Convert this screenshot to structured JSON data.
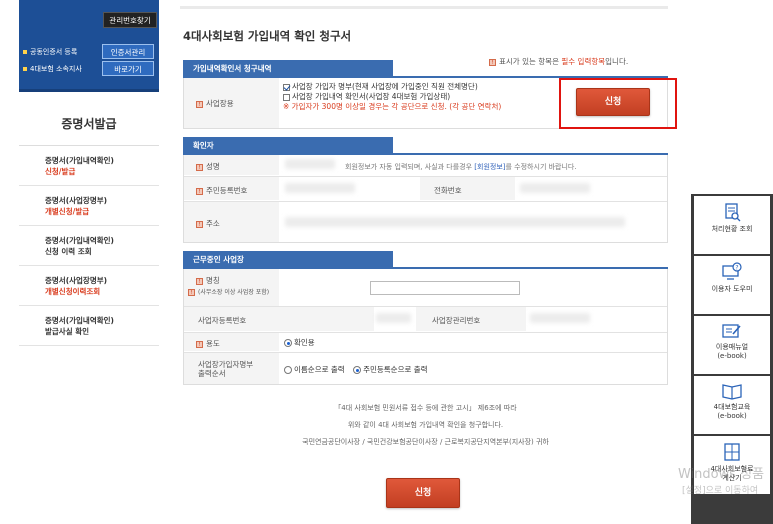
{
  "sidebar": {
    "find_button": "관리번호찾기",
    "rows": [
      {
        "label": "공동인증서 등록",
        "button": "인증서관리"
      },
      {
        "label": "4대보험 소속지사",
        "button": "바로가기"
      }
    ],
    "menu_title": "증명서발급",
    "items": [
      {
        "line1": "증명서(가입내역확인)",
        "line2": "신청/발급"
      },
      {
        "line1": "증명서(사업장명부)",
        "line2": "개별신청/발급"
      },
      {
        "line1": "증명서(가입내역확인)",
        "line2": "신청 이력 조회"
      },
      {
        "line1": "증명서(사업장명부)",
        "line2": "개별신청이력조회"
      },
      {
        "line1": "증명서(가입내역확인)",
        "line2": "발급사실 확인"
      }
    ]
  },
  "main": {
    "title": "4대사회보험 가입내역 확인 청구서",
    "required_note": {
      "prefix": "표시가 있는 항목은",
      "highlight": "필수 입력항목",
      "suffix": "입니다."
    },
    "section1": {
      "tab": "가입내역확인서 청구내역",
      "field_label": "사업장용",
      "options": [
        {
          "label": "사업장 가입자 명부(현재 사업장에 가입중인 직원 전체명단)",
          "checked": true
        },
        {
          "label": "사업장 가입내역 확인서(사업장 4대보험 가입상태)",
          "checked": false
        }
      ],
      "note": "※ 가입자가 300명 이상일 경우는 각 공단으로 신청. (각 공단 연락처)",
      "apply_button": "신청"
    },
    "section2": {
      "tab": "확인자",
      "name_label": "성명",
      "info_note": {
        "prefix": "회원정보가 자동 입력되며, 사실과 다를경우 ",
        "link": "[회원정보]",
        "suffix": "를 수정하시기 바랍니다."
      },
      "rrn_label": "주민등록번호",
      "phone_label": "전화번호",
      "address_label": "주소"
    },
    "section3": {
      "tab": "근무중인 사업장",
      "name_label": "명칭",
      "name_sub_label": "(사무소장 이상 사업장 포함)",
      "bizno_label": "사업자등록번호",
      "mgmtno_label": "사업장관리번호",
      "purpose_label": "용도",
      "purpose_option": "확인용",
      "order_label_1": "사업장가입자명부",
      "order_label_2": "출력순서",
      "order_options": [
        {
          "label": "이름순으로 출력",
          "selected": false
        },
        {
          "label": "주민등록순으로 출력",
          "selected": true
        }
      ]
    },
    "footer": {
      "line1": "「4대 사회보험 민원서류 접수 등에 관한 고시」 제6조에 따라",
      "line2": "위와 같이 4대 사회보험 가입내역 확인을 청구합니다.",
      "line3": "국민연금공단이사장 / 국민건강보험공단이사장 / 근로복지공단지역본부(지사장) 귀하"
    },
    "submit_button": "신청"
  },
  "quick_panel": {
    "items": [
      {
        "label": "처리현황 조회"
      },
      {
        "label": "이용자 도우미"
      },
      {
        "label": "이용매뉴얼",
        "sub": "(e-book)"
      },
      {
        "label": "4대보험교육",
        "sub": "(e-book)"
      },
      {
        "label": "4대사회보험료",
        "sub": "계산기"
      }
    ]
  },
  "watermark": {
    "line1": "Windows 정품",
    "line2": "[설정]으로 이동하여"
  },
  "colors": {
    "accent_blue": "#3a6cb0",
    "button_red": "#c94a2c",
    "highlight_red": "#e0140f"
  }
}
